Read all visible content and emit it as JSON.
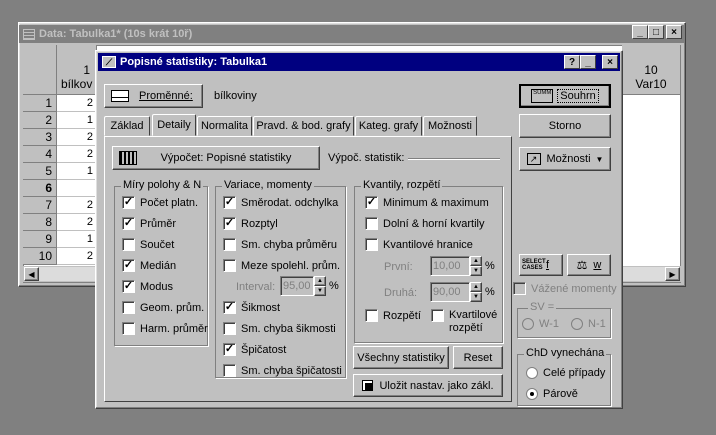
{
  "data_window": {
    "title": "Data: Tabulka1* (10s krát 10ř)",
    "col1_num": "1",
    "col1_name": "bílkov",
    "col10_num": "10",
    "col10_name": "Var10",
    "row_numbers": [
      "1",
      "2",
      "3",
      "4",
      "5",
      "6",
      "7",
      "8",
      "9",
      "10"
    ],
    "cells": [
      "2",
      "1",
      "2",
      "2",
      "1",
      "",
      "2",
      "2",
      "1",
      "2"
    ]
  },
  "dialog": {
    "title": "Popisné statistiky: Tabulka1",
    "help": "?",
    "variables_label": "Proměnné:",
    "variable_value": "bílkoviny",
    "summary_label": "Souhrn",
    "cancel_label": "Storno",
    "options_label": "Možnosti",
    "tabs": [
      "Základ",
      "Detaily",
      "Normalita",
      "Pravd. & bod. grafy",
      "Kateg. grafy",
      "Možnosti"
    ],
    "compute_label": "Výpočet: Popisné statistiky",
    "compute_stats_label": "Výpoč. statistik:",
    "group_location": "Míry polohy & N",
    "location_items": [
      {
        "label": "Počet platn.",
        "checked": true
      },
      {
        "label": "Průměr",
        "checked": true
      },
      {
        "label": "Součet",
        "checked": false
      },
      {
        "label": "Medián",
        "checked": true
      },
      {
        "label": "Modus",
        "checked": true
      },
      {
        "label": "Geom. prům.",
        "checked": false
      },
      {
        "label": "Harm. průměr",
        "checked": false
      }
    ],
    "group_variation": "Variace, momenty",
    "variation_items": [
      {
        "label": "Směrodat. odchylka",
        "checked": true
      },
      {
        "label": "Rozptyl",
        "checked": true
      },
      {
        "label": "Sm. chyba průměru",
        "checked": false
      },
      {
        "label": "Meze spolehl. prům.",
        "checked": false
      }
    ],
    "interval_label": "Interval:",
    "interval_value": "95,00",
    "pct": "%",
    "variation_items2": [
      {
        "label": "Šikmost",
        "checked": true
      },
      {
        "label": "Sm. chyba šikmosti",
        "checked": false
      },
      {
        "label": "Špičatost",
        "checked": true
      },
      {
        "label": "Sm. chyba špičatosti",
        "checked": false
      }
    ],
    "group_quantiles": "Kvantily, rozpětí",
    "quantile_items": [
      {
        "label": "Minimum & maximum",
        "checked": true
      },
      {
        "label": "Dolní & horní kvartily",
        "checked": false
      },
      {
        "label": "Kvantilové hranice",
        "checked": false
      }
    ],
    "first_label": "První:",
    "first_value": "10,00",
    "second_label": "Druhá:",
    "second_value": "90,00",
    "range_label": "Rozpětí",
    "range_checked": false,
    "iqr_label": "Kvartilové rozpětí",
    "iqr_checked": false,
    "all_stats_label": "Všechny statistiky",
    "reset_label": "Reset",
    "save_label": "Uložit nastav. jako zákl.",
    "select_cases": "SELECT CASES",
    "select_f": "f",
    "weight_w": "w",
    "weighted_label": "Vážené momenty",
    "sv_label": "SV =",
    "sv_opt1": "W-1",
    "sv_opt2": "N-1",
    "md_group": "ChD vynechána",
    "md_opt1": "Celé případy",
    "md_opt2": "Párově"
  }
}
